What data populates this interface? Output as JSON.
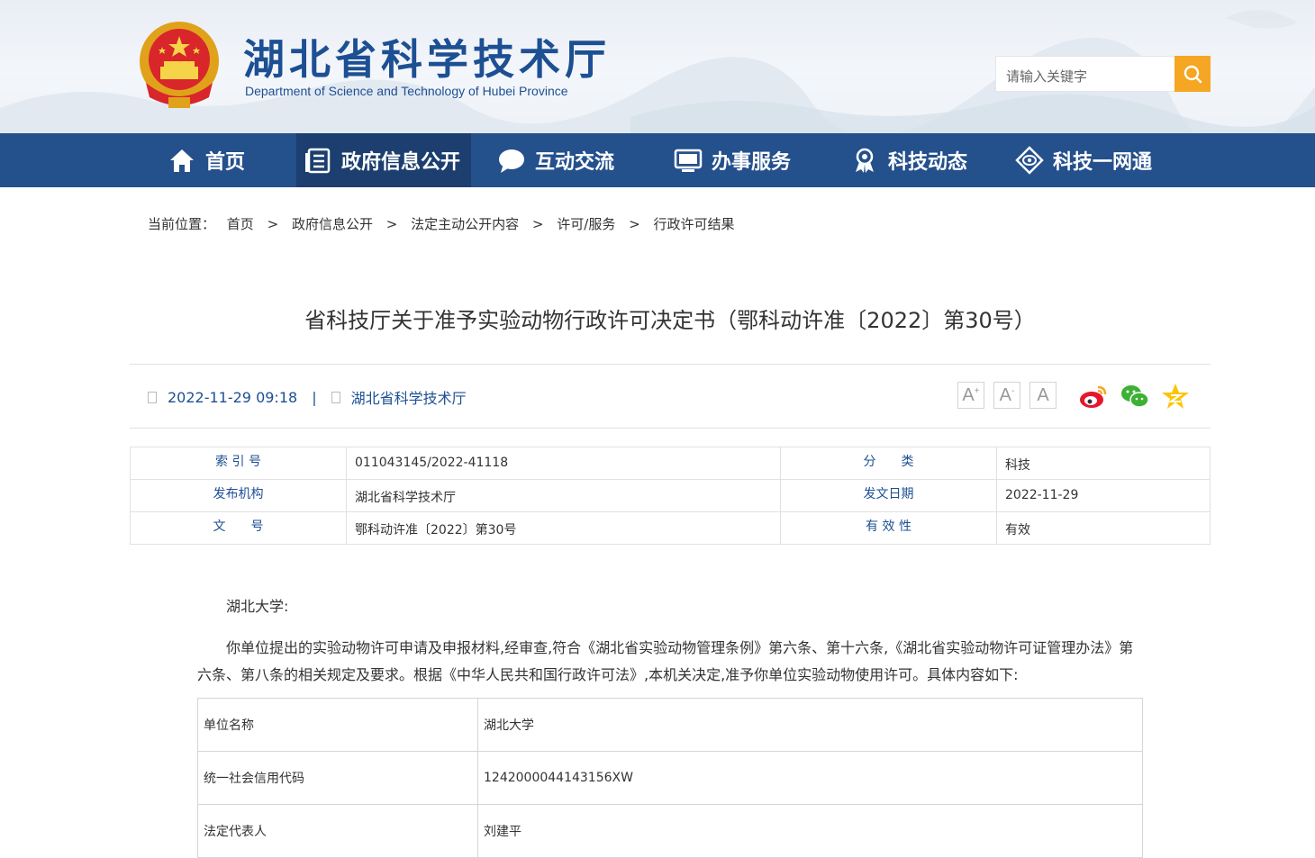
{
  "header": {
    "site_title": "湖北省科学技术厅",
    "site_subtitle": "Department of Science and Technology of Hubei Province",
    "search_placeholder": "请输入关键字",
    "accent_color": "#f5a623",
    "brand_color": "#24508c"
  },
  "nav": {
    "items": [
      {
        "label": "首页",
        "icon": "home-icon"
      },
      {
        "label": "政府信息公开",
        "icon": "document-list-icon",
        "active": true
      },
      {
        "label": "互动交流",
        "icon": "chat-bubble-icon"
      },
      {
        "label": "办事服务",
        "icon": "monitor-icon"
      },
      {
        "label": "科技动态",
        "icon": "award-icon"
      },
      {
        "label": "科技一网通",
        "icon": "eye-diamond-icon"
      }
    ]
  },
  "breadcrumb": {
    "prefix": "当前位置：",
    "items": [
      "首页",
      "政府信息公开",
      "法定主动公开内容",
      "许可/服务",
      "行政许可结果"
    ],
    "separator": ">"
  },
  "article": {
    "title": "省科技厅关于准予实验动物行政许可决定书（鄂科动许准〔2022〕第30号）",
    "date": "2022-11-29 09:18",
    "meta_separator": "|",
    "source": "湖北省科学技术厅",
    "font_buttons": [
      "A",
      "A",
      "A"
    ],
    "font_marks": [
      "+",
      "-"
    ],
    "share_icons": [
      "weibo-icon",
      "wechat-icon",
      "qzone-star-icon"
    ]
  },
  "info_table": {
    "rows": [
      {
        "label1": "索 引 号",
        "value1": "011043145/2022-41118",
        "label2": "分　　类",
        "value2": "科技"
      },
      {
        "label1": "发布机构",
        "value1": "湖北省科学技术厅",
        "label2": "发文日期",
        "value2": "2022-11-29"
      },
      {
        "label1": "文　　号",
        "value1": "鄂科动许准〔2022〕第30号",
        "label2": "有 效 性",
        "value2": "有效"
      }
    ]
  },
  "body": {
    "salutation": "湖北大学:",
    "paragraph_line1": "你单位提出的实验动物许可申请及申报材料,经审查,符合《湖北省实验动物管理条例》第六条、第十六条,《湖北省实验动物许可证管理办法》第",
    "paragraph_line2": "六条、第八条的相关规定及要求。根据《中华人民共和国行政许可法》,本机关决定,准予你单位实验动物使用许可。具体内容如下:"
  },
  "detail_table": {
    "rows": [
      {
        "key": "单位名称",
        "value": "湖北大学"
      },
      {
        "key": "统一社会信用代码",
        "value": "1242000044143156XW"
      },
      {
        "key": "法定代表人",
        "value": "刘建平"
      }
    ]
  }
}
